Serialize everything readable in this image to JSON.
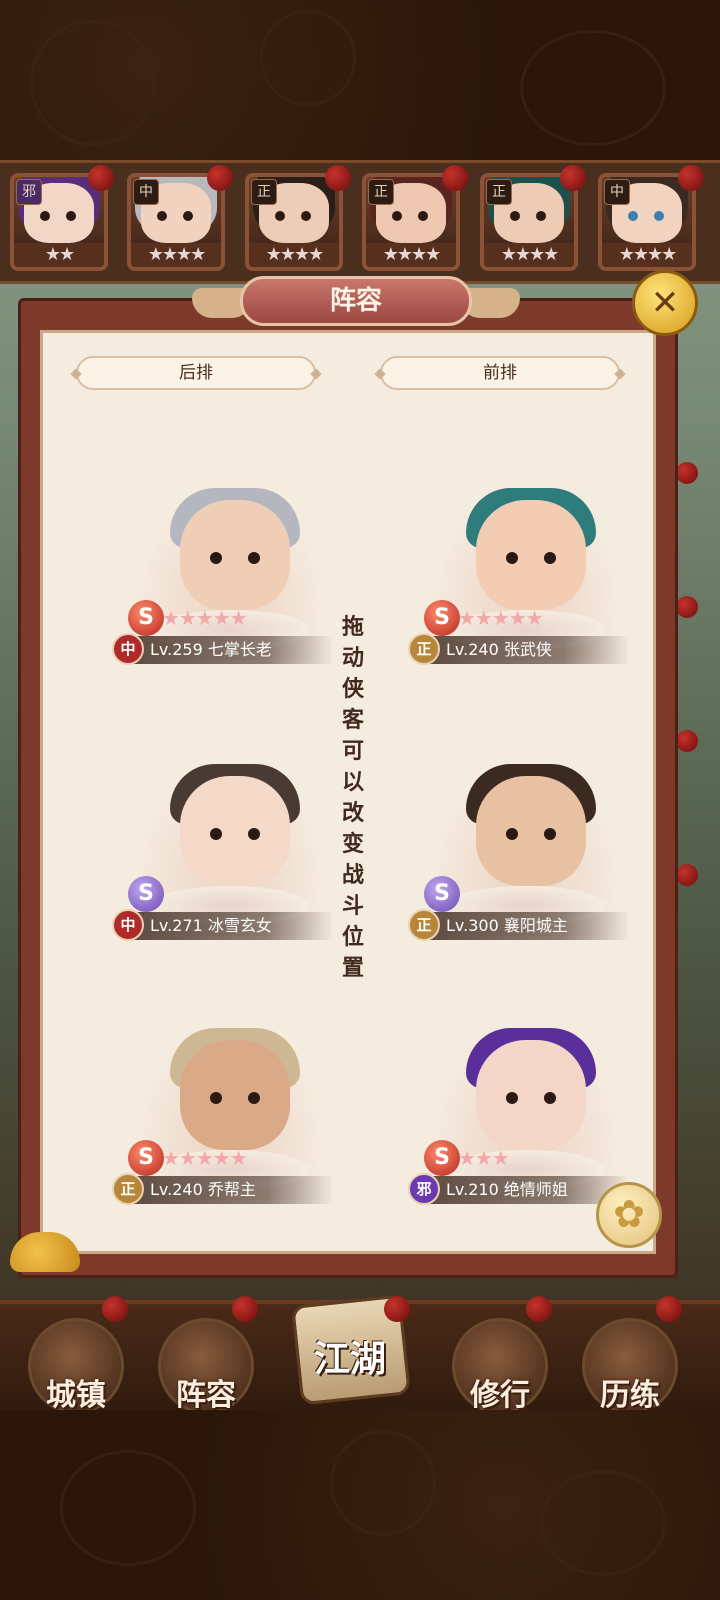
{
  "panel": {
    "title": "阵容",
    "close_icon": "crossed-swords-icon",
    "back_row_label": "后排",
    "front_row_label": "前排",
    "drag_hint": "拖动侠客可以改变战斗位置",
    "settings_icon": "flower-icon"
  },
  "hero_strip": [
    {
      "faction": "邪",
      "stars": "★★"
    },
    {
      "faction": "中",
      "stars": "★★★★"
    },
    {
      "faction": "正",
      "stars": "★★★★"
    },
    {
      "faction": "正",
      "stars": "★★★★"
    },
    {
      "faction": "正",
      "stars": "★★★★"
    },
    {
      "faction": "中",
      "stars": "★★★★"
    }
  ],
  "formation": {
    "back": [
      {
        "faction": "中",
        "level": "Lv.259",
        "name": "七掌长老",
        "stars": "★★★★★"
      },
      {
        "faction": "中",
        "level": "Lv.271",
        "name": "冰雪玄女",
        "stars": ""
      },
      {
        "faction": "正",
        "level": "Lv.240",
        "name": "乔帮主",
        "stars": "★★★★★"
      }
    ],
    "front": [
      {
        "faction": "正",
        "level": "Lv.240",
        "name": "张武侠",
        "stars": "★★★★★"
      },
      {
        "faction": "正",
        "level": "Lv.300",
        "name": "襄阳城主",
        "stars": ""
      },
      {
        "faction": "邪",
        "level": "Lv.210",
        "name": "绝情师姐",
        "stars": "★★★"
      }
    ]
  },
  "bottom_nav": [
    {
      "label": "城镇"
    },
    {
      "label": "阵容"
    },
    {
      "label": "江湖"
    },
    {
      "label": "修行"
    },
    {
      "label": "历练"
    }
  ]
}
